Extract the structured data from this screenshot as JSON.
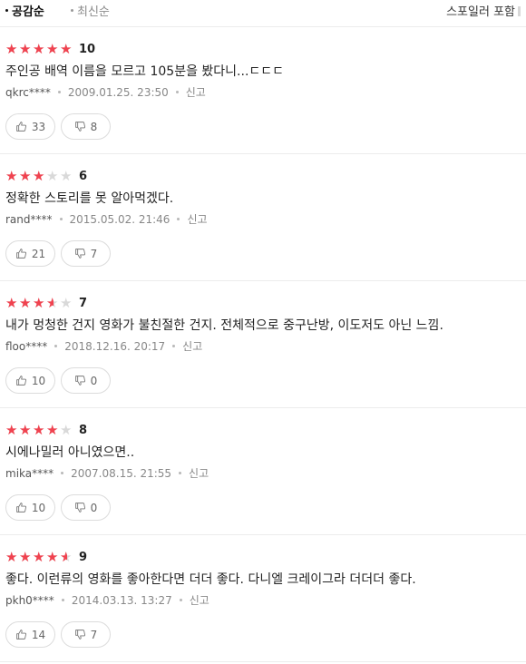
{
  "sort": {
    "popular_label": "공감순",
    "latest_label": "최신순",
    "spoiler_label": "스포일러 포함"
  },
  "reviews": [
    {
      "rating": 10,
      "rating_text": "10",
      "text": "주인공 배역 이름을 모르고 105분을 봤다니...ㄷㄷㄷ",
      "author": "qkrc****",
      "date": "2009.01.25. 23:50",
      "report_label": "신고",
      "likes": "33",
      "dislikes": "8"
    },
    {
      "rating": 6,
      "rating_text": "6",
      "text": "정확한 스토리를 못 알아먹겠다.",
      "author": "rand****",
      "date": "2015.05.02. 21:46",
      "report_label": "신고",
      "likes": "21",
      "dislikes": "7"
    },
    {
      "rating": 7,
      "rating_text": "7",
      "text": "내가 멍청한 건지 영화가 불친절한 건지. 전체적으로 중구난방, 이도저도 아닌 느낌.",
      "author": "floo****",
      "date": "2018.12.16. 20:17",
      "report_label": "신고",
      "likes": "10",
      "dislikes": "0"
    },
    {
      "rating": 8,
      "rating_text": "8",
      "text": "시에나밀러 아니였으면..",
      "author": "mika****",
      "date": "2007.08.15. 21:55",
      "report_label": "신고",
      "likes": "10",
      "dislikes": "0"
    },
    {
      "rating": 9,
      "rating_text": "9",
      "text": "좋다. 이런류의 영화를 좋아한다면 더더 좋다. 다니엘 크레이그라 더더더 좋다.",
      "author": "pkh0****",
      "date": "2014.03.13. 13:27",
      "report_label": "신고",
      "likes": "14",
      "dislikes": "7"
    }
  ],
  "icons": {
    "like": "thumbs-up-icon",
    "dislike": "thumbs-down-icon",
    "star": "star-icon"
  },
  "colors": {
    "star_filled": "#f0424f",
    "star_empty": "#d9d9d9"
  }
}
